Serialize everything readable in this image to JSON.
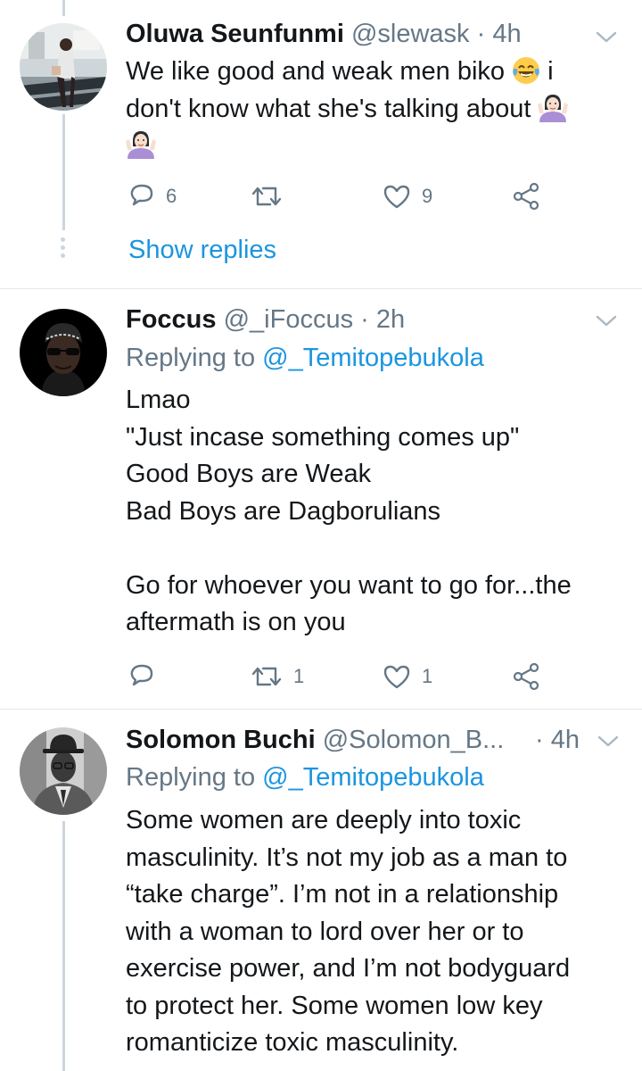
{
  "tweets": [
    {
      "name": "Oluwa Seunfunmi",
      "handle": "@slewask",
      "time": "· 4h",
      "lines": [
        "We like good and weak men biko",
        "i",
        "don't know what she's talking about"
      ],
      "reply_count": "6",
      "retweet_count": "",
      "like_count": "9",
      "show_replies": "Show replies"
    },
    {
      "name": "Foccus",
      "handle": "@_iFoccus",
      "time": "· 2h",
      "replying_prefix": "Replying to",
      "replying_to": "@_Temitopebukola",
      "lines": [
        "Lmao",
        "\"Just incase something comes up\"",
        "Good Boys are Weak",
        "Bad Boys are Dagborulians",
        "",
        "Go for whoever you want to go for...the",
        "aftermath is on you"
      ],
      "reply_count": "",
      "retweet_count": "1",
      "like_count": "1"
    },
    {
      "name": "Solomon Buchi",
      "handle": "@Solomon_B...",
      "time": "· 4h",
      "replying_prefix": "Replying to",
      "replying_to": "@_Temitopebukola",
      "lines": [
        "Some women are deeply into toxic",
        "masculinity. It’s not my job as a man to",
        "“take charge”. I’m not in a relationship",
        "with a woman to lord over her or to",
        "exercise power, and I’m not bodyguard",
        "to protect her. Some women low key",
        "romanticize toxic masculinity."
      ]
    }
  ],
  "icons": {
    "reply": "reply-icon",
    "retweet": "retweet-icon",
    "like": "heart-icon",
    "share": "share-icon",
    "caret": "chevron-down-icon",
    "emoji_laugh": "face-with-tears-of-joy",
    "emoji_shrug": "woman-shrugging"
  },
  "colors": {
    "link": "#1b95e0",
    "secondary_text": "#657786",
    "thread_line": "#ccd6dd",
    "divider": "#e1e8ed"
  }
}
